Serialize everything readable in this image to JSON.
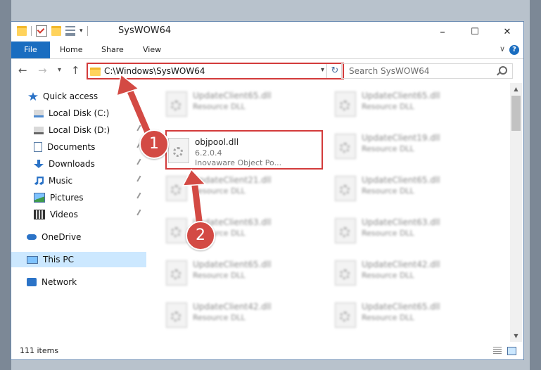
{
  "window": {
    "title": "SysWOW64"
  },
  "window_controls": {
    "minimize": "–",
    "maximize": "☐",
    "close": "✕"
  },
  "ribbon": {
    "tabs": [
      "File",
      "Home",
      "Share",
      "View"
    ]
  },
  "nav": {
    "back": "←",
    "forward": "→",
    "recent": "▾",
    "up": "↑",
    "address": "C:\\Windows\\SysWOW64",
    "search_placeholder": "Search SysWOW64"
  },
  "sidebar": {
    "items": [
      {
        "label": "Quick access",
        "icon": "star-icon"
      },
      {
        "label": "Local Disk (C:)",
        "icon": "disk-icon",
        "pinned": true
      },
      {
        "label": "Local Disk (D:)",
        "icon": "disk-icon",
        "pinned": true
      },
      {
        "label": "Documents",
        "icon": "documents-icon",
        "pinned": true
      },
      {
        "label": "Downloads",
        "icon": "downloads-icon",
        "pinned": true
      },
      {
        "label": "Music",
        "icon": "music-icon",
        "pinned": true
      },
      {
        "label": "Pictures",
        "icon": "pictures-icon",
        "pinned": true
      },
      {
        "label": "Videos",
        "icon": "videos-icon",
        "pinned": true
      },
      {
        "label": "OneDrive",
        "icon": "onedrive-icon"
      },
      {
        "label": "This PC",
        "icon": "this-pc-icon",
        "selected": true
      },
      {
        "label": "Network",
        "icon": "network-icon"
      }
    ]
  },
  "files": {
    "highlighted": {
      "name": "objpool.dll",
      "version": "6.2.0.4",
      "description": "Inovaware Object Po..."
    },
    "blurred": [
      {
        "name": "UpdateClient65.dll",
        "type": "Resource DLL"
      },
      {
        "name": "UpdateClient65.dll",
        "type": "Resource DLL"
      },
      {
        "name": "UpdateClient19.dll",
        "type": "Resource DLL"
      },
      {
        "name": "UpdateClient21.dll",
        "type": "Resource DLL"
      },
      {
        "name": "UpdateClient65.dll",
        "type": "Resource DLL"
      },
      {
        "name": "UpdateClient63.dll",
        "type": "Resource DLL"
      },
      {
        "name": "UpdateClient63.dll",
        "type": "Resource DLL"
      },
      {
        "name": "UpdateClient65.dll",
        "type": "Resource DLL"
      },
      {
        "name": "UpdateClient42.dll",
        "type": "Resource DLL"
      },
      {
        "name": "UpdateClient42.dll",
        "type": "Resource DLL"
      },
      {
        "name": "UpdateClient65.dll",
        "type": "Resource DLL"
      }
    ]
  },
  "status": {
    "item_count": "111 items"
  },
  "annotations": {
    "badge1": "1",
    "badge2": "2"
  },
  "colors": {
    "accent": "#1a6dc0",
    "highlight_border": "#d33b3b",
    "selection": "#cce8ff"
  }
}
